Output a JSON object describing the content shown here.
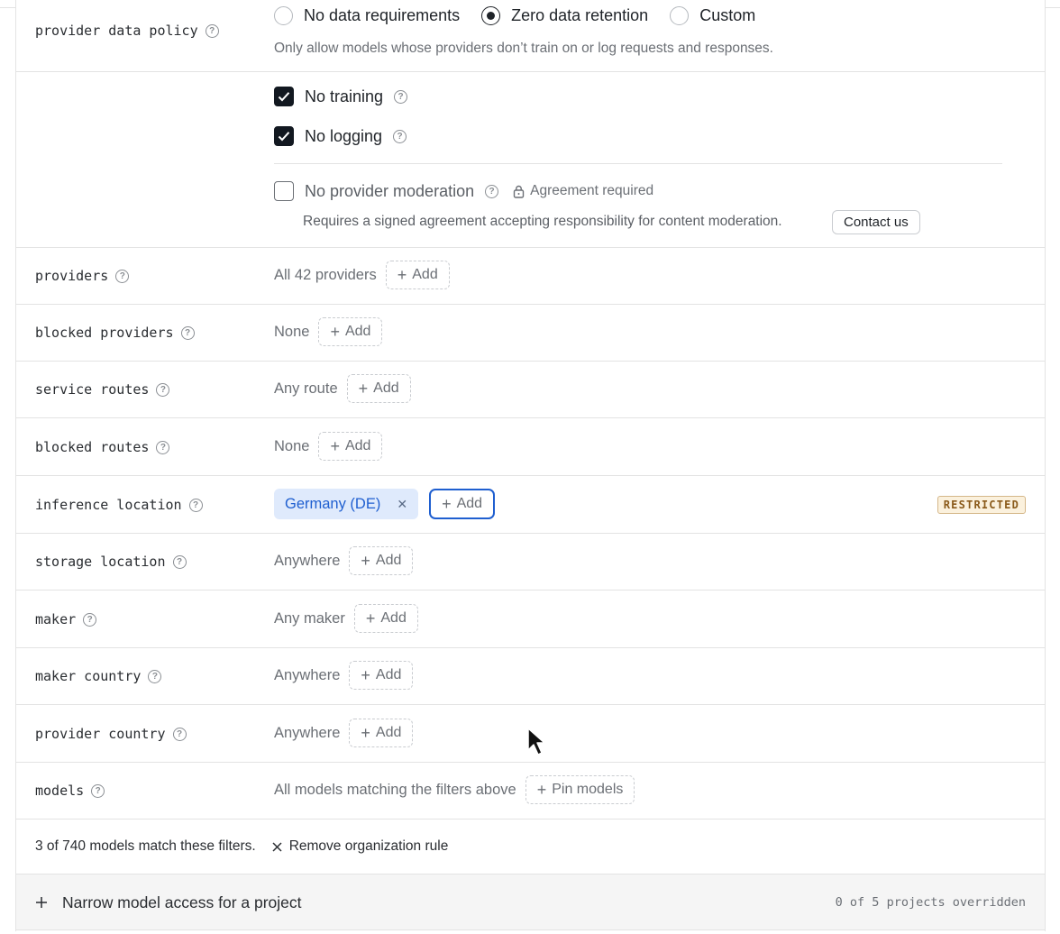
{
  "policy": {
    "label": "provider data policy",
    "options": [
      {
        "label": "No data requirements",
        "selected": false
      },
      {
        "label": "Zero data retention",
        "selected": true
      },
      {
        "label": "Custom",
        "selected": false
      }
    ],
    "description": "Only allow models whose providers don’t train on or log requests and responses.",
    "no_training": {
      "label": "No training",
      "checked": true
    },
    "no_logging": {
      "label": "No logging",
      "checked": true
    },
    "no_moderation": {
      "label": "No provider moderation",
      "checked": false
    },
    "agreement_label": "Agreement required",
    "agreement_description": "Requires a signed agreement accepting responsibility for content moderation.",
    "contact_label": "Contact us"
  },
  "add_label": "Add",
  "rows": {
    "providers": {
      "label": "providers",
      "value": "All 42 providers"
    },
    "blocked_providers": {
      "label": "blocked providers",
      "value": "None"
    },
    "service_routes": {
      "label": "service routes",
      "value": "Any route"
    },
    "blocked_routes": {
      "label": "blocked routes",
      "value": "None"
    },
    "inference_location": {
      "label": "inference location",
      "chip": "Germany (DE)",
      "badge": "RESTRICTED"
    },
    "storage_location": {
      "label": "storage location",
      "value": "Anywhere"
    },
    "maker": {
      "label": "maker",
      "value": "Any maker"
    },
    "maker_country": {
      "label": "maker country",
      "value": "Anywhere"
    },
    "provider_country": {
      "label": "provider country",
      "value": "Anywhere"
    },
    "models": {
      "label": "models",
      "value": "All models matching the filters above",
      "pin_label": "Pin models"
    }
  },
  "summary": {
    "match_text": "3 of 740 models match these filters.",
    "remove_label": "Remove organization rule"
  },
  "footer": {
    "narrow_label": "Narrow model access for a project",
    "overridden_text": "0 of 5 projects overridden"
  }
}
